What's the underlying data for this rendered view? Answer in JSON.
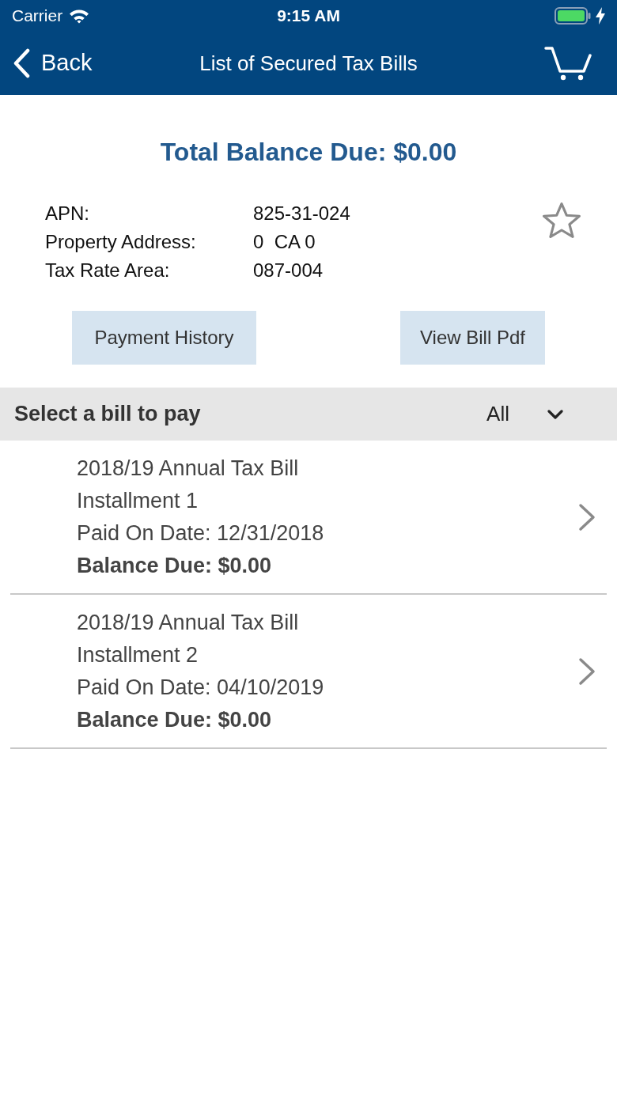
{
  "status_bar": {
    "carrier": "Carrier",
    "time": "9:15 AM"
  },
  "nav_bar": {
    "back_label": "Back",
    "title": "List of Secured Tax Bills"
  },
  "total_balance": "Total Balance Due: $0.00",
  "property": {
    "favorite": false,
    "fields": [
      {
        "label": "APN:",
        "value": "825-31-024"
      },
      {
        "label": "Property Address:",
        "value": "0  CA 0"
      },
      {
        "label": "Tax Rate Area:",
        "value": "087-004"
      }
    ]
  },
  "buttons": [
    "Payment History",
    "View Bill Pdf"
  ],
  "bill_section": {
    "title": "Select a bill to pay",
    "filter": "All"
  },
  "bills": [
    {
      "title": "2018/19 Annual Tax Bill",
      "installment": "Installment 1",
      "paid_on": "Paid On Date: 12/31/2018",
      "balance": "Balance Due: $0.00"
    },
    {
      "title": "2018/19 Annual Tax Bill",
      "installment": "Installment 2",
      "paid_on": "Paid On Date: 04/10/2019",
      "balance": "Balance Due: $0.00"
    }
  ]
}
